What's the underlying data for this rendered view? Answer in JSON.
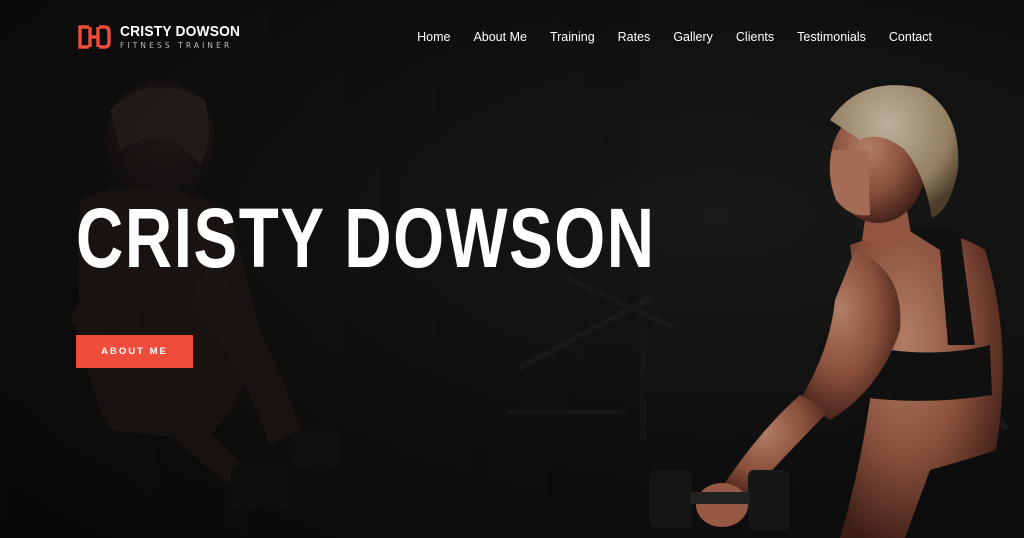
{
  "brand": {
    "initials_icon": "ch-monogram-icon",
    "name": "CRISTY DOWSON",
    "tagline": "FITNESS TRAINER",
    "accent_color": "#ef4c3b"
  },
  "nav": {
    "items": [
      {
        "label": "Home"
      },
      {
        "label": "About Me"
      },
      {
        "label": "Training"
      },
      {
        "label": "Rates"
      },
      {
        "label": "Gallery"
      },
      {
        "label": "Clients"
      },
      {
        "label": "Testimonials"
      },
      {
        "label": "Contact"
      }
    ]
  },
  "hero": {
    "title": "CRISTY DOWSON",
    "cta_label": "ABOUT ME",
    "background": "athlete-with-dumbbells-photo"
  }
}
